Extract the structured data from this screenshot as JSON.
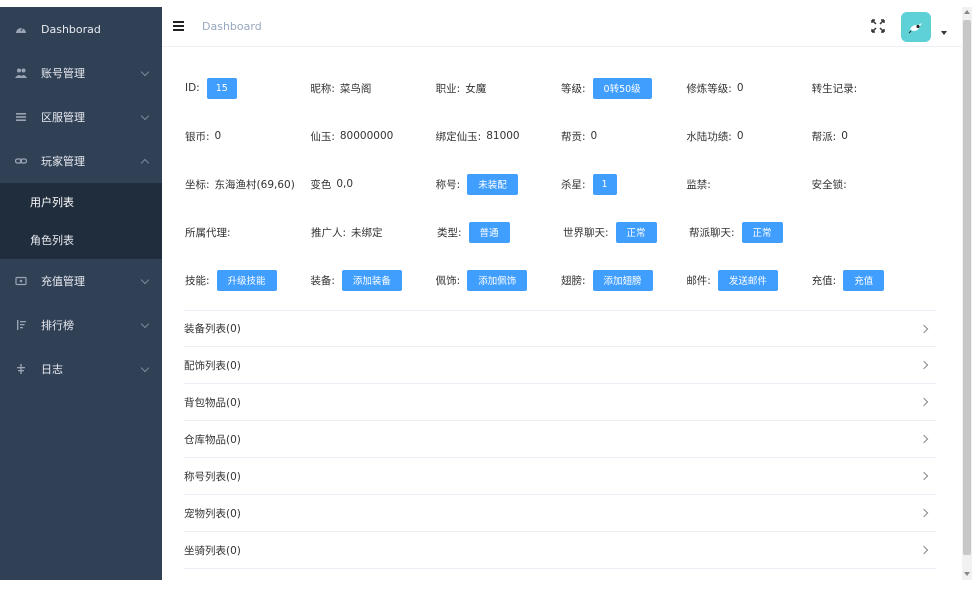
{
  "sidebar": {
    "items": [
      {
        "label": "Dashborad",
        "icon": "dashboard-icon"
      },
      {
        "label": "账号管理",
        "icon": "users-icon"
      },
      {
        "label": "区服管理",
        "icon": "list-icon"
      },
      {
        "label": "玩家管理",
        "icon": "link-icon"
      },
      {
        "label": "充值管理",
        "icon": "wallet-icon"
      },
      {
        "label": "排行榜",
        "icon": "sort-icon"
      },
      {
        "label": "日志",
        "icon": "tree-icon"
      }
    ],
    "submenu": [
      {
        "label": "用户列表"
      },
      {
        "label": "角色列表"
      }
    ]
  },
  "header": {
    "breadcrumb": "Dashboard"
  },
  "player": {
    "rows": [
      [
        {
          "label": "ID:",
          "tag": "15"
        },
        {
          "label": "昵称:",
          "value": "菜鸟阁"
        },
        {
          "label": "职业:",
          "value": "女魔"
        },
        {
          "label": "等级:",
          "tag": "0转50级"
        },
        {
          "label": "修炼等级:",
          "value": "0"
        },
        {
          "label": "转生记录:",
          "value": ""
        }
      ],
      [
        {
          "label": "银币:",
          "value": "0"
        },
        {
          "label": "仙玉:",
          "value": "80000000"
        },
        {
          "label": "绑定仙玉:",
          "value": "81000"
        },
        {
          "label": "帮贡:",
          "value": "0"
        },
        {
          "label": "水陆功绩:",
          "value": "0"
        },
        {
          "label": "帮派:",
          "value": "0"
        }
      ],
      [
        {
          "label": "坐标:",
          "value": "东海渔村(69,60)"
        },
        {
          "label": "变色",
          "value": "0,0"
        },
        {
          "label": "称号:",
          "tag": "未装配"
        },
        {
          "label": "杀星:",
          "tag": "1"
        },
        {
          "label": "监禁:",
          "value": ""
        },
        {
          "label": "安全锁:",
          "value": ""
        }
      ],
      [
        {
          "label": "所属代理:",
          "value": ""
        },
        {
          "label": "推广人:",
          "value": "未绑定"
        },
        {
          "label": "类型:",
          "tag": "普通"
        },
        {
          "label": "世界聊天:",
          "tag": "正常"
        },
        {
          "label": "帮派聊天:",
          "tag": "正常"
        }
      ],
      [
        {
          "label": "技能:",
          "tag": "升级技能"
        },
        {
          "label": "装备:",
          "tag": "添加装备"
        },
        {
          "label": "佩饰:",
          "tag": "添加佩饰"
        },
        {
          "label": "翅膀:",
          "tag": "添加翅膀"
        },
        {
          "label": "邮件:",
          "tag": "发送邮件"
        },
        {
          "label": "充值:",
          "tag": "充值"
        }
      ]
    ]
  },
  "collapse": [
    {
      "label": "装备列表(0)"
    },
    {
      "label": "配饰列表(0)"
    },
    {
      "label": "背包物品(0)"
    },
    {
      "label": "仓库物品(0)"
    },
    {
      "label": "称号列表(0)"
    },
    {
      "label": "宠物列表(0)"
    },
    {
      "label": "坐骑列表(0)"
    }
  ],
  "colors": {
    "sidebar": "#304156",
    "submenu": "#1f2d3d",
    "accent": "#409eff",
    "avatar": "#5ed1d6"
  }
}
